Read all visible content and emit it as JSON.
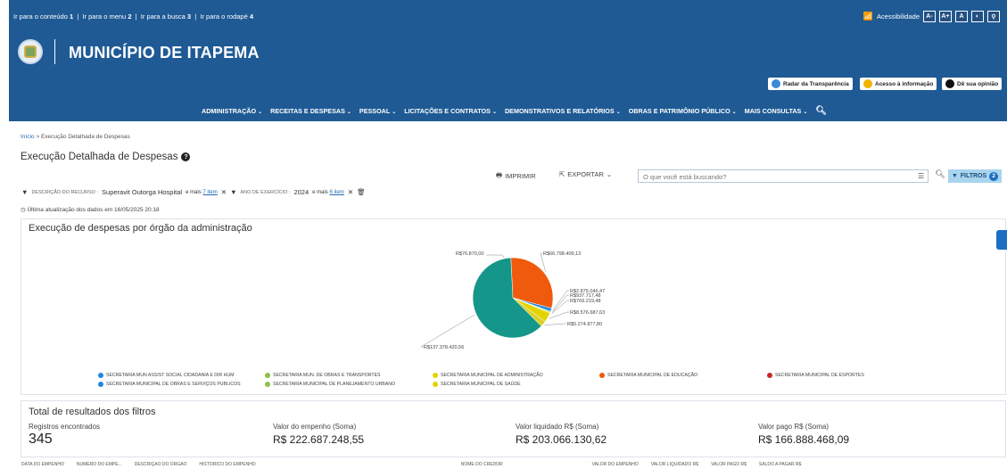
{
  "skip_links": {
    "item1": "Ir para o conteúdo",
    "key1": "1",
    "item2": "Ir para o menu",
    "key2": "2",
    "item3": "Ir para a busca",
    "key3": "3",
    "item4": "Ir para o rodapé",
    "key4": "4"
  },
  "accessibility": {
    "label": "Acessibilidade",
    "buttons": [
      "A-",
      "A+",
      "A",
      "◐",
      "⚲"
    ]
  },
  "header": {
    "title": "MUNICÍPIO DE ITAPEMA"
  },
  "quick_links": {
    "radar": "Radar da Transparência",
    "acesso": "Acesso à informação",
    "opiniao": "Dê sua opinião"
  },
  "nav": {
    "items": [
      "ADMINISTRAÇÃO",
      "RECEITAS E DESPESAS",
      "PESSOAL",
      "LICITAÇÕES E CONTRATOS",
      "DEMONSTRATIVOS E RELATÓRIOS",
      "OBRAS E PATRIMÔNIO PÚBLICO",
      "MAIS CONSULTAS"
    ]
  },
  "breadcrumb": {
    "home": "Início",
    "sep": ">",
    "current": "Execução Detalhada de Despesas"
  },
  "page": {
    "title": "Execução Detalhada de Despesas"
  },
  "toolbar": {
    "print": "IMPRIMIR",
    "export": "EXPORTAR",
    "search_placeholder": "O que você está buscando?",
    "filters": "FILTROS",
    "filters_count": "2"
  },
  "chips": {
    "c1_label": "DESCRIÇÃO DO RECURSO :",
    "c1_value": "Superavit Outorga Hospital",
    "c1_more": "e mais",
    "c1_more_link": "7 item",
    "c2_label": "ANO DE EXERCÍCIO :",
    "c2_value": "2024",
    "c2_more": "e mais",
    "c2_more_link": "6 item"
  },
  "update": {
    "text": "Última atualização dos dados em 16/05/2025 20:18"
  },
  "colors": {
    "header_bg": "#1f5a94",
    "teal": "#14968a",
    "orange": "#f05a0c",
    "green": "#8bc34a",
    "yellow": "#e3d400",
    "blue": "#1e88e5"
  },
  "chart_data": {
    "type": "pie",
    "title": "Execução de despesas por órgão da administração",
    "slices": [
      {
        "label": "R$137.378.420,56",
        "value": 137378420.56,
        "color": "#14968a"
      },
      {
        "label": "R$66.798.409,13",
        "value": 66798409.13,
        "color": "#f05a0c"
      },
      {
        "label": "R$2.875.046,47",
        "value": 2875046.47,
        "color": "#1e88e5"
      },
      {
        "label": "R$937.717,48",
        "value": 937717.48,
        "color": "#8bc34a"
      },
      {
        "label": "R$769.219,48",
        "value": 769219.48,
        "color": "#c0ca33"
      },
      {
        "label": "R$8.576.687,63",
        "value": 8576687.63,
        "color": "#e3d400"
      },
      {
        "label": "R$5.274.877,80",
        "value": 5274877.8,
        "color": "#dcd02a"
      },
      {
        "label": "R$76.870,00",
        "value": 76870.0,
        "color": "#c62828"
      }
    ],
    "legend": [
      "SECRETARIA MUN ASSIST SOCIAL CIDADANIA E DIR HUM",
      "SECRETARIA MUN. DE OBRAS E TRANSPORTES",
      "SECRETARIA MUNICIPAL DE ADMINISTRAÇÃO",
      "SECRETARIA MUNICIPAL DE EDUCAÇÃO",
      "SECRETARIA MUNICIPAL DE ESPORTES",
      "SECRETARIA MUNICIPAL DE OBRAS E SERVIÇOS PUBLICOS",
      "SECRETARIA MUNICIPAL DE PLANEJAMENTO URBANO",
      "SECRETARIA MUNICIPAL DE SAÚDE"
    ],
    "legend_colors": [
      "#1e88e5",
      "#8bc34a",
      "#e3d400",
      "#f05a0c",
      "#c62828",
      "#1e88e5",
      "#8bc34a",
      "#e3d400"
    ]
  },
  "totals": {
    "title": "Total de resultados dos filtros",
    "registros_label": "Registros encontrados",
    "registros_value": "345",
    "empenho_label": "Valor do empenho (Soma)",
    "empenho_value": "R$ 222.687.248,55",
    "liquidado_label": "Valor liquidado R$ (Soma)",
    "liquidado_value": "R$ 203.066.130,62",
    "pago_label": "Valor pago R$ (Soma)",
    "pago_value": "R$ 166.888.468,09"
  },
  "table": {
    "headers": [
      "DATA DO EMPENHO",
      "NÚMERO DO EMPE...",
      "DESCRIÇÃO DO ÓRGÃO",
      "HISTÓRICO DO EMPENHO",
      "NOME DO CREDOR",
      "VALOR DO EMPENHO",
      "VALOR LIQUIDADO R$",
      "VALOR PAGO R$",
      "SALDO A PAGAR R$"
    ]
  }
}
